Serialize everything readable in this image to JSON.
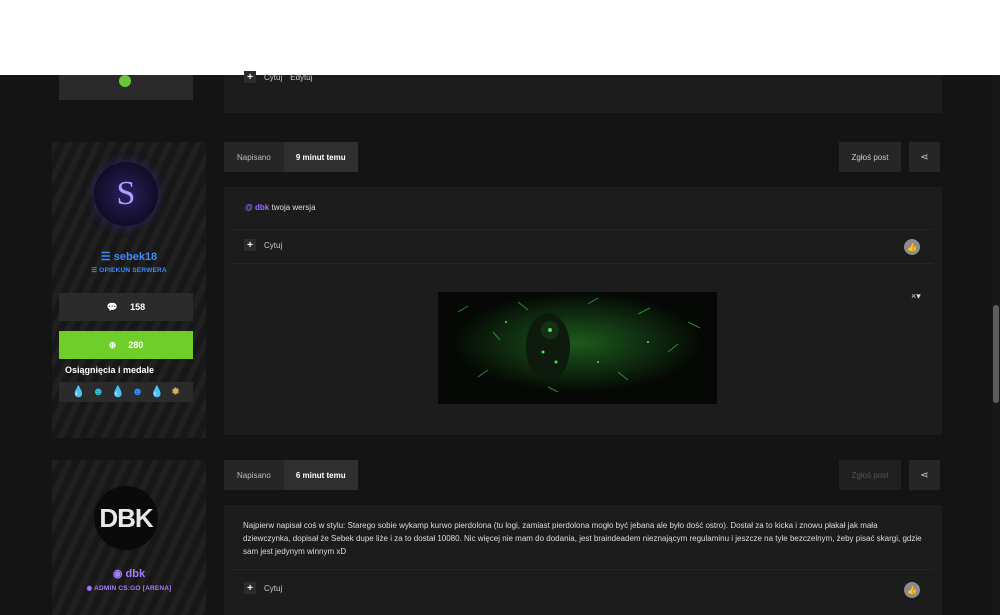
{
  "previous_post": {
    "quote_label": "Cytuj",
    "edit_label": "Edytuj"
  },
  "posts": [
    {
      "author": {
        "username": "sebek18",
        "role": "OPIEKUN SERWERA",
        "avatar_letter": "S",
        "posts_count": "158",
        "reputation": "280",
        "achievements_title": "Osiągnięcia i medale"
      },
      "header": {
        "label": "Napisano",
        "time": "9 minut temu",
        "report_label": "Zgłoś post"
      },
      "mention": "dbk",
      "text": "twoja wersja",
      "quote_label": "Cytuj",
      "signature_close": "×▾"
    },
    {
      "author": {
        "username": "dbk",
        "role": "ADMIN CS:GO [ARENA]",
        "avatar_text": "DBK"
      },
      "header": {
        "label": "Napisano",
        "time": "6 minut temu",
        "report_label": "Zgłoś post"
      },
      "text": "Najpierw napisał coś w stylu: Starego sobie wykamp kurwo pierdolona (tu logi, zamiast pierdolona mogło być jebana ale było dość ostro). Dostał za to kicka i znowu płakał jak mała dziewczynka, dopisał że Sebek dupe liże i za to dostał 10080. Nic więcej nie mam do dodania, jest braindeadem nieznającym regulaminu i jeszcze na tyle bezczelnym, żeby pisać skargi, gdzie sam jest jedynym winnym xD",
      "quote_label": "Cytuj"
    }
  ],
  "colors": {
    "accent_blue": "#3d8bff",
    "reputation_green": "#6fce2a",
    "mention_purple": "#9b6bff",
    "admin_purple": "#a97cff"
  },
  "icons": [
    "chat-bubble-icon",
    "plus-circle-icon",
    "share-icon",
    "thumbs-up-icon",
    "layers-icon",
    "shield-icon",
    "medal-icon"
  ]
}
